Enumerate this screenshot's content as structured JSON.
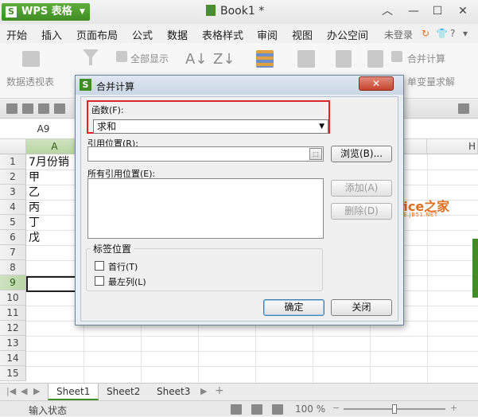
{
  "app": {
    "menu_label": "WPS 表格",
    "logo_letter": "S",
    "document_title": "Book1 *"
  },
  "menu_tabs": [
    "开始",
    "插入",
    "页面布局",
    "公式",
    "数据",
    "表格样式",
    "审阅",
    "视图",
    "办公空间"
  ],
  "menubar_right": {
    "login": "未登录"
  },
  "ribbon": {
    "pivot": "数据透视表",
    "show_all": "全部显示",
    "merge_calc": "合并计算",
    "single_var": "单变量求解"
  },
  "name_box": "A9",
  "columns": [
    "A",
    "H"
  ],
  "rows": [
    "1",
    "2",
    "3",
    "4",
    "5",
    "6",
    "7",
    "8",
    "9",
    "10",
    "11",
    "12",
    "13",
    "14",
    "15"
  ],
  "cells": [
    "7月份销",
    "甲",
    "乙",
    "丙",
    "丁",
    "戊"
  ],
  "sheets": [
    "Sheet1",
    "Sheet2",
    "Sheet3"
  ],
  "status": {
    "mode": "输入状态",
    "zoom": "100 %",
    "zoom_level_pct": 100
  },
  "dialog": {
    "title": "合并计算",
    "logo_letter": "S",
    "close_label": "关闭",
    "function_label": "函数(F):",
    "function_value": "求和",
    "reference_label": "引用位置(R):",
    "reference_value": "",
    "browse_label": "浏览(B)...",
    "all_references_label": "所有引用位置(E):",
    "add_label": "添加(A)",
    "delete_label": "删除(D)",
    "label_group_title": "标签位置",
    "first_row_label": "首行(T)",
    "first_row_checked": false,
    "left_column_label": "最左列(L)",
    "left_column_checked": false,
    "ok_label": "确定",
    "cancel_label": "关闭"
  },
  "watermark": {
    "main": "office之家",
    "sub": "OFFICE.JB51.NET"
  }
}
